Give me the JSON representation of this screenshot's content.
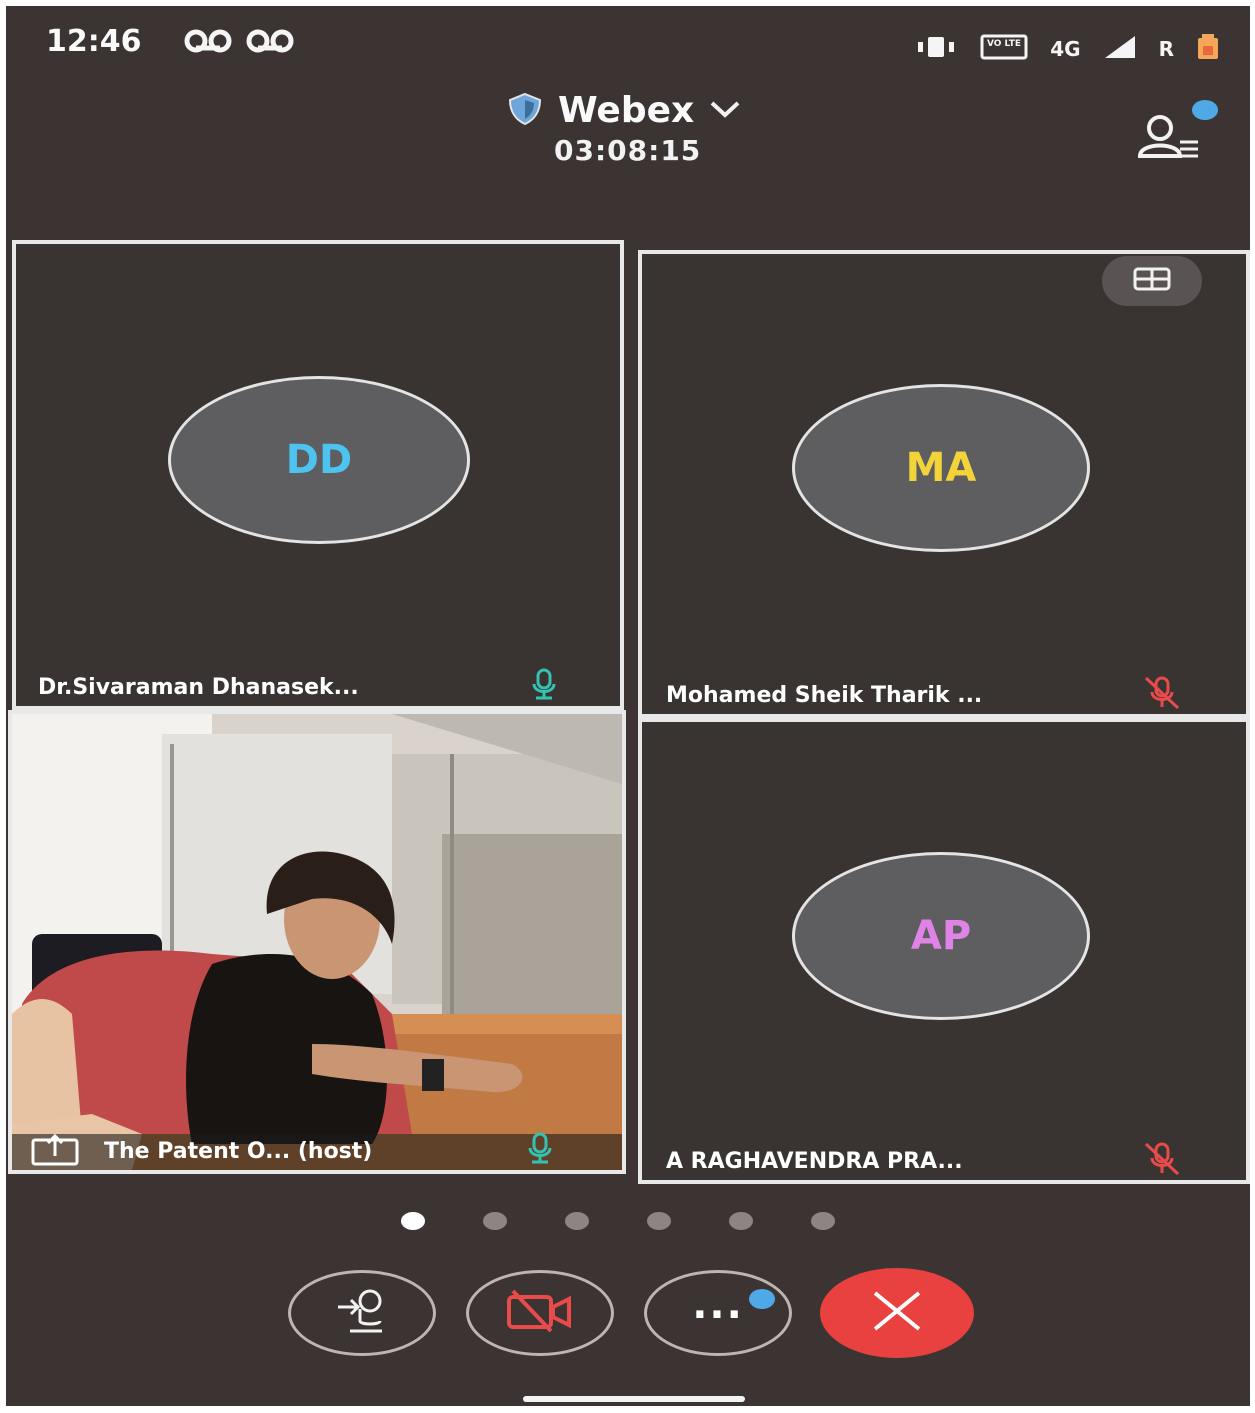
{
  "status_bar": {
    "time": "12:46",
    "left_icons": [
      "voicemail-icon",
      "voicemail-icon"
    ],
    "volte_label": "VO LTE",
    "network_label": "4G",
    "roaming_label": "R",
    "right_icons": [
      "vibrate-icon",
      "volte-icon",
      "signal-icon",
      "battery-icon"
    ]
  },
  "header": {
    "app_title": "Webex",
    "elapsed_time": "03:08:15",
    "title_icon": "shield-icon",
    "dropdown_icon": "chevron-down-icon",
    "participants_icon": "participants-list-icon"
  },
  "tiles": [
    {
      "initials": "DD",
      "name": "Dr.Sivaraman Dhanasek...",
      "initials_color": "#4dc3ef",
      "mic_state": "unmuted",
      "mic_color": "#35c2b0"
    },
    {
      "initials": "MA",
      "name": "Mohamed Sheik Tharik ...",
      "initials_color": "#f2d43a",
      "mic_state": "muted",
      "mic_color": "#e94b4b"
    },
    {
      "name": "The Patent O... (host)",
      "video": true,
      "share_icon": "share-screen-icon",
      "mic_state": "unmuted",
      "mic_color": "#35c2b0"
    },
    {
      "initials": "AP",
      "name": "A RAGHAVENDRA PRA...",
      "initials_color": "#e083e6",
      "mic_state": "muted",
      "mic_color": "#e94b4b"
    }
  ],
  "layout_toggle_icon": "grid-layout-icon",
  "pagination": {
    "pages": 6,
    "active_index": 0
  },
  "controls": [
    {
      "name": "audio-connect-button",
      "icon": "audio-connect-icon"
    },
    {
      "name": "video-toggle-button",
      "icon": "video-off-icon"
    },
    {
      "name": "more-options-button",
      "icon": "more-icon",
      "label": "..."
    },
    {
      "name": "end-call-button",
      "icon": "close-icon"
    }
  ],
  "colors": {
    "background": "#3b3433",
    "accent_blue": "#4fa9e6",
    "end_call_red": "#e8413f"
  }
}
